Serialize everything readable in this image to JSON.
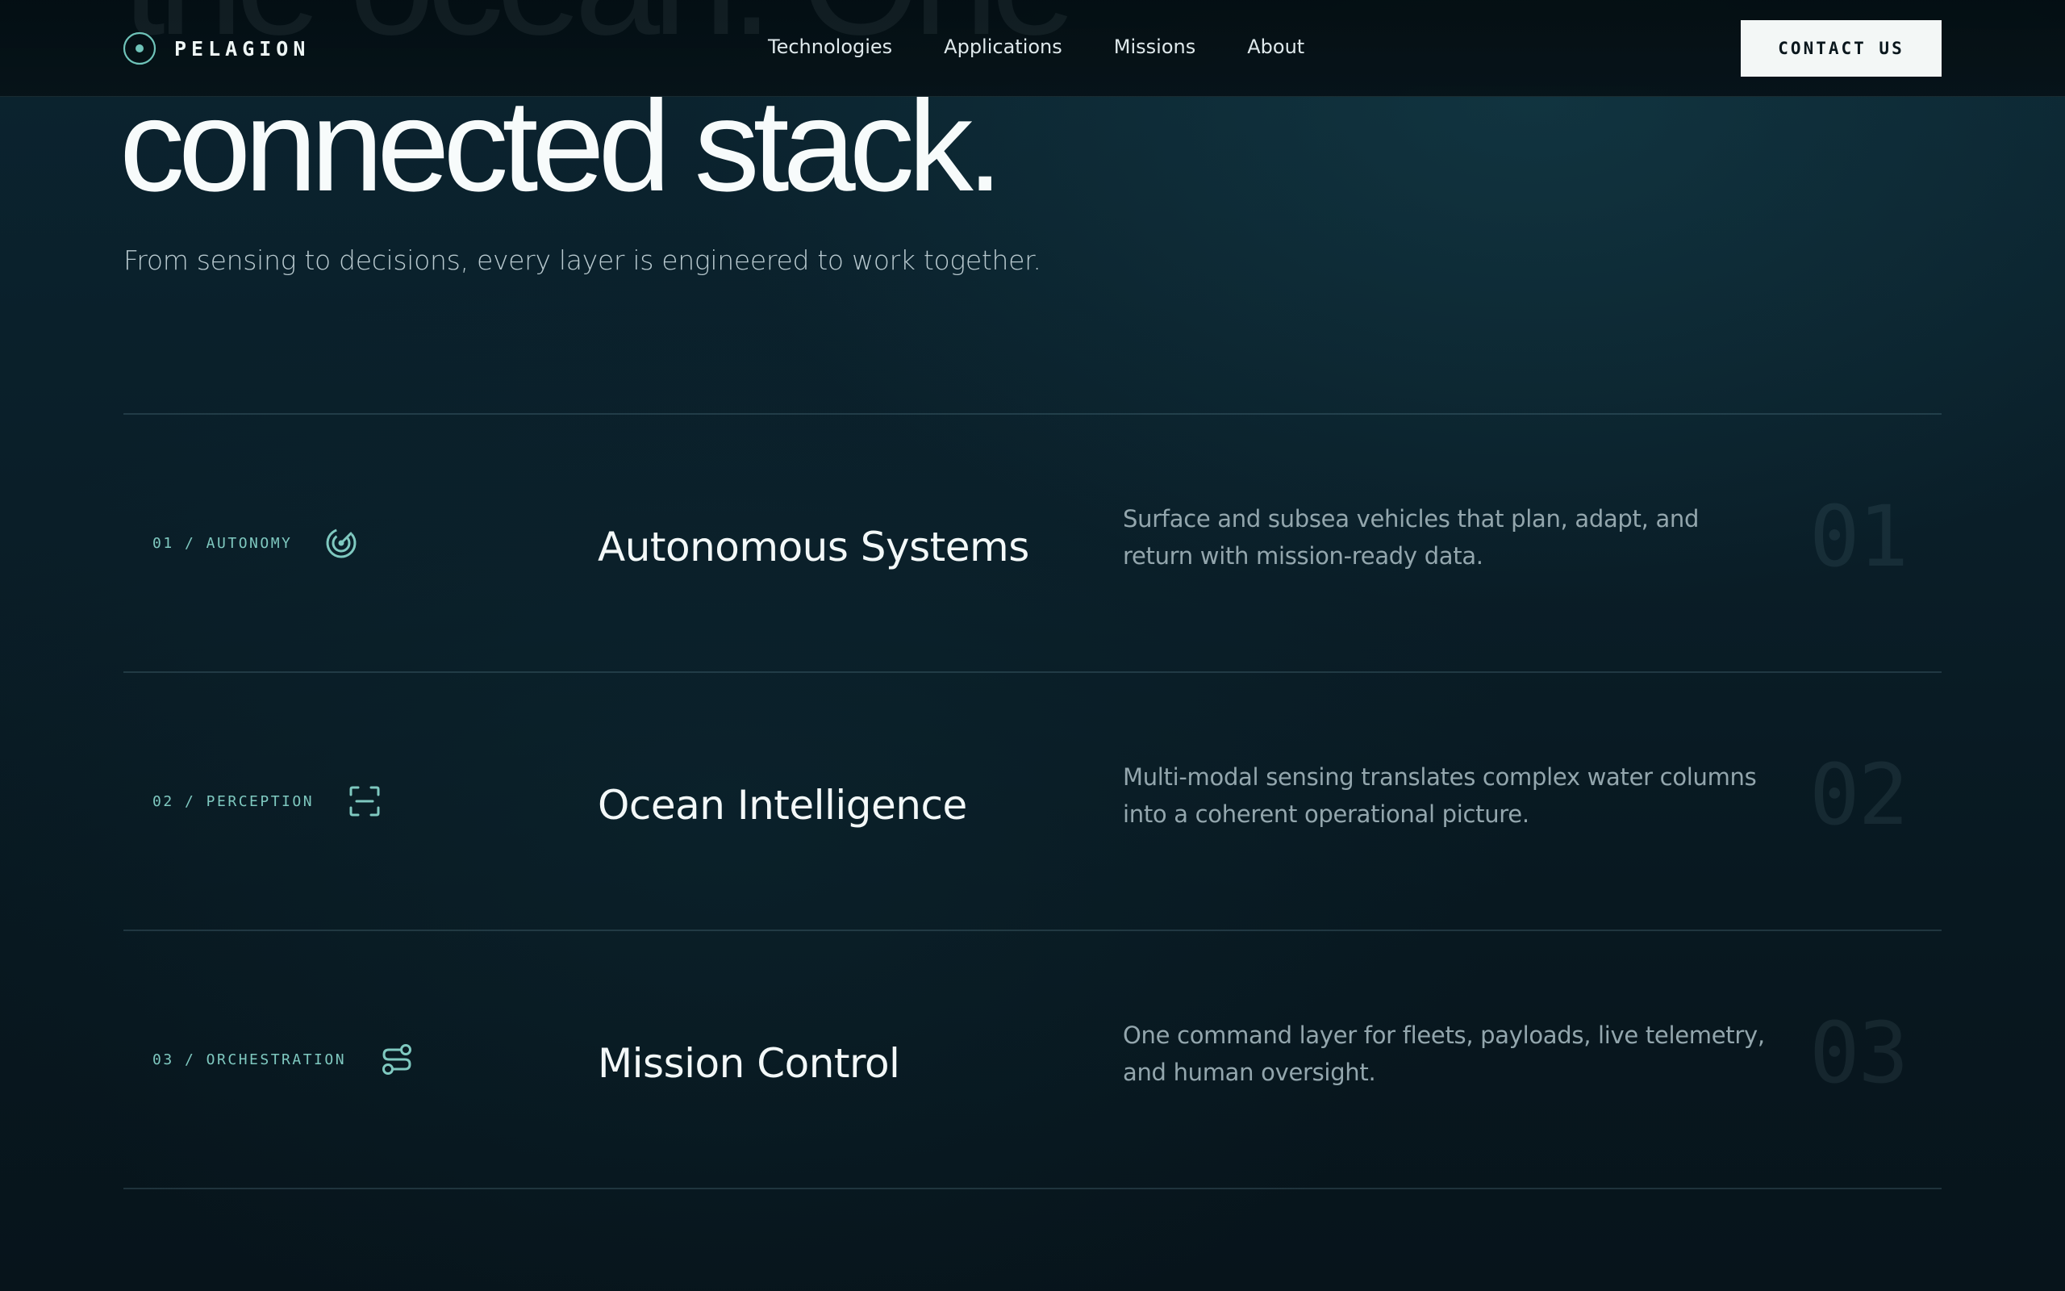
{
  "nav": {
    "ghost_title": "the ocean. One",
    "brand": "PELAGION",
    "links": [
      "Technologies",
      "Applications",
      "Missions",
      "About"
    ],
    "cta": "CONTACT US"
  },
  "hero": {
    "title": "connected stack.",
    "subtitle": "From sensing to decisions, every layer is engineered to work together."
  },
  "stack": [
    {
      "tag": "01 / AUTONOMY",
      "icon": "radar-icon",
      "title": "Autonomous Systems",
      "description": "Surface and subsea vehicles that plan, adapt, and return with mission-ready data.",
      "number": "01"
    },
    {
      "tag": "02 / PERCEPTION",
      "icon": "scan-icon",
      "title": "Ocean Intelligence",
      "description": "Multi-modal sensing translates complex water columns into a coherent operational picture.",
      "number": "02"
    },
    {
      "tag": "03 / ORCHESTRATION",
      "icon": "route-icon",
      "title": "Mission Control",
      "description": "One command layer for fleets, payloads, live telemetry, and human oversight.",
      "number": "03"
    }
  ],
  "colors": {
    "accent": "#7fc9c0",
    "background": "#0a1e28",
    "cta_background": "#f3f7f6"
  }
}
